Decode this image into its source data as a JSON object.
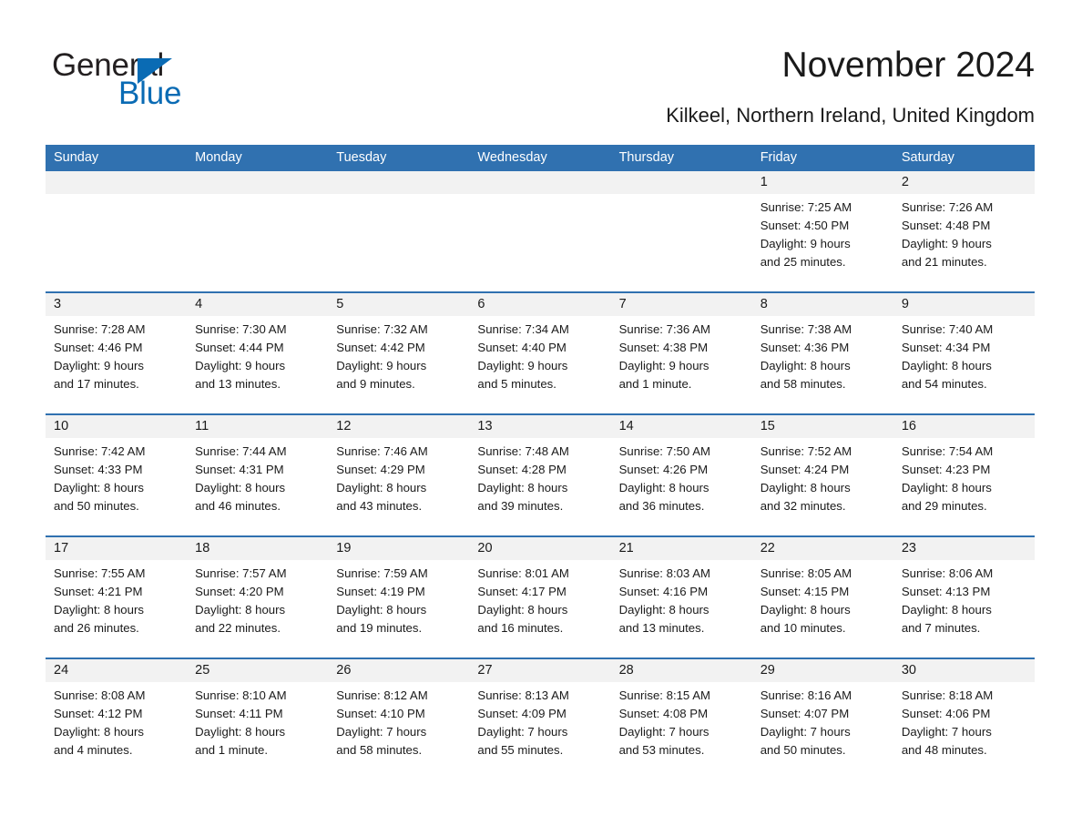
{
  "brand": {
    "name_part1": "General",
    "name_part2": "Blue",
    "color_dark": "#231f20",
    "color_blue": "#0a6bb4"
  },
  "header": {
    "title": "November 2024",
    "subtitle": "Kilkeel, Northern Ireland, United Kingdom",
    "accent_color": "#3071b0",
    "date_band_color": "#f2f2f2"
  },
  "weekdays": [
    "Sunday",
    "Monday",
    "Tuesday",
    "Wednesday",
    "Thursday",
    "Friday",
    "Saturday"
  ],
  "weeks": [
    {
      "days": [
        {
          "num": "",
          "lines": []
        },
        {
          "num": "",
          "lines": []
        },
        {
          "num": "",
          "lines": []
        },
        {
          "num": "",
          "lines": []
        },
        {
          "num": "",
          "lines": []
        },
        {
          "num": "1",
          "lines": [
            "Sunrise: 7:25 AM",
            "Sunset: 4:50 PM",
            "Daylight: 9 hours",
            "and 25 minutes."
          ]
        },
        {
          "num": "2",
          "lines": [
            "Sunrise: 7:26 AM",
            "Sunset: 4:48 PM",
            "Daylight: 9 hours",
            "and 21 minutes."
          ]
        }
      ]
    },
    {
      "days": [
        {
          "num": "3",
          "lines": [
            "Sunrise: 7:28 AM",
            "Sunset: 4:46 PM",
            "Daylight: 9 hours",
            "and 17 minutes."
          ]
        },
        {
          "num": "4",
          "lines": [
            "Sunrise: 7:30 AM",
            "Sunset: 4:44 PM",
            "Daylight: 9 hours",
            "and 13 minutes."
          ]
        },
        {
          "num": "5",
          "lines": [
            "Sunrise: 7:32 AM",
            "Sunset: 4:42 PM",
            "Daylight: 9 hours",
            "and 9 minutes."
          ]
        },
        {
          "num": "6",
          "lines": [
            "Sunrise: 7:34 AM",
            "Sunset: 4:40 PM",
            "Daylight: 9 hours",
            "and 5 minutes."
          ]
        },
        {
          "num": "7",
          "lines": [
            "Sunrise: 7:36 AM",
            "Sunset: 4:38 PM",
            "Daylight: 9 hours",
            "and 1 minute."
          ]
        },
        {
          "num": "8",
          "lines": [
            "Sunrise: 7:38 AM",
            "Sunset: 4:36 PM",
            "Daylight: 8 hours",
            "and 58 minutes."
          ]
        },
        {
          "num": "9",
          "lines": [
            "Sunrise: 7:40 AM",
            "Sunset: 4:34 PM",
            "Daylight: 8 hours",
            "and 54 minutes."
          ]
        }
      ]
    },
    {
      "days": [
        {
          "num": "10",
          "lines": [
            "Sunrise: 7:42 AM",
            "Sunset: 4:33 PM",
            "Daylight: 8 hours",
            "and 50 minutes."
          ]
        },
        {
          "num": "11",
          "lines": [
            "Sunrise: 7:44 AM",
            "Sunset: 4:31 PM",
            "Daylight: 8 hours",
            "and 46 minutes."
          ]
        },
        {
          "num": "12",
          "lines": [
            "Sunrise: 7:46 AM",
            "Sunset: 4:29 PM",
            "Daylight: 8 hours",
            "and 43 minutes."
          ]
        },
        {
          "num": "13",
          "lines": [
            "Sunrise: 7:48 AM",
            "Sunset: 4:28 PM",
            "Daylight: 8 hours",
            "and 39 minutes."
          ]
        },
        {
          "num": "14",
          "lines": [
            "Sunrise: 7:50 AM",
            "Sunset: 4:26 PM",
            "Daylight: 8 hours",
            "and 36 minutes."
          ]
        },
        {
          "num": "15",
          "lines": [
            "Sunrise: 7:52 AM",
            "Sunset: 4:24 PM",
            "Daylight: 8 hours",
            "and 32 minutes."
          ]
        },
        {
          "num": "16",
          "lines": [
            "Sunrise: 7:54 AM",
            "Sunset: 4:23 PM",
            "Daylight: 8 hours",
            "and 29 minutes."
          ]
        }
      ]
    },
    {
      "days": [
        {
          "num": "17",
          "lines": [
            "Sunrise: 7:55 AM",
            "Sunset: 4:21 PM",
            "Daylight: 8 hours",
            "and 26 minutes."
          ]
        },
        {
          "num": "18",
          "lines": [
            "Sunrise: 7:57 AM",
            "Sunset: 4:20 PM",
            "Daylight: 8 hours",
            "and 22 minutes."
          ]
        },
        {
          "num": "19",
          "lines": [
            "Sunrise: 7:59 AM",
            "Sunset: 4:19 PM",
            "Daylight: 8 hours",
            "and 19 minutes."
          ]
        },
        {
          "num": "20",
          "lines": [
            "Sunrise: 8:01 AM",
            "Sunset: 4:17 PM",
            "Daylight: 8 hours",
            "and 16 minutes."
          ]
        },
        {
          "num": "21",
          "lines": [
            "Sunrise: 8:03 AM",
            "Sunset: 4:16 PM",
            "Daylight: 8 hours",
            "and 13 minutes."
          ]
        },
        {
          "num": "22",
          "lines": [
            "Sunrise: 8:05 AM",
            "Sunset: 4:15 PM",
            "Daylight: 8 hours",
            "and 10 minutes."
          ]
        },
        {
          "num": "23",
          "lines": [
            "Sunrise: 8:06 AM",
            "Sunset: 4:13 PM",
            "Daylight: 8 hours",
            "and 7 minutes."
          ]
        }
      ]
    },
    {
      "days": [
        {
          "num": "24",
          "lines": [
            "Sunrise: 8:08 AM",
            "Sunset: 4:12 PM",
            "Daylight: 8 hours",
            "and 4 minutes."
          ]
        },
        {
          "num": "25",
          "lines": [
            "Sunrise: 8:10 AM",
            "Sunset: 4:11 PM",
            "Daylight: 8 hours",
            "and 1 minute."
          ]
        },
        {
          "num": "26",
          "lines": [
            "Sunrise: 8:12 AM",
            "Sunset: 4:10 PM",
            "Daylight: 7 hours",
            "and 58 minutes."
          ]
        },
        {
          "num": "27",
          "lines": [
            "Sunrise: 8:13 AM",
            "Sunset: 4:09 PM",
            "Daylight: 7 hours",
            "and 55 minutes."
          ]
        },
        {
          "num": "28",
          "lines": [
            "Sunrise: 8:15 AM",
            "Sunset: 4:08 PM",
            "Daylight: 7 hours",
            "and 53 minutes."
          ]
        },
        {
          "num": "29",
          "lines": [
            "Sunrise: 8:16 AM",
            "Sunset: 4:07 PM",
            "Daylight: 7 hours",
            "and 50 minutes."
          ]
        },
        {
          "num": "30",
          "lines": [
            "Sunrise: 8:18 AM",
            "Sunset: 4:06 PM",
            "Daylight: 7 hours",
            "and 48 minutes."
          ]
        }
      ]
    }
  ]
}
